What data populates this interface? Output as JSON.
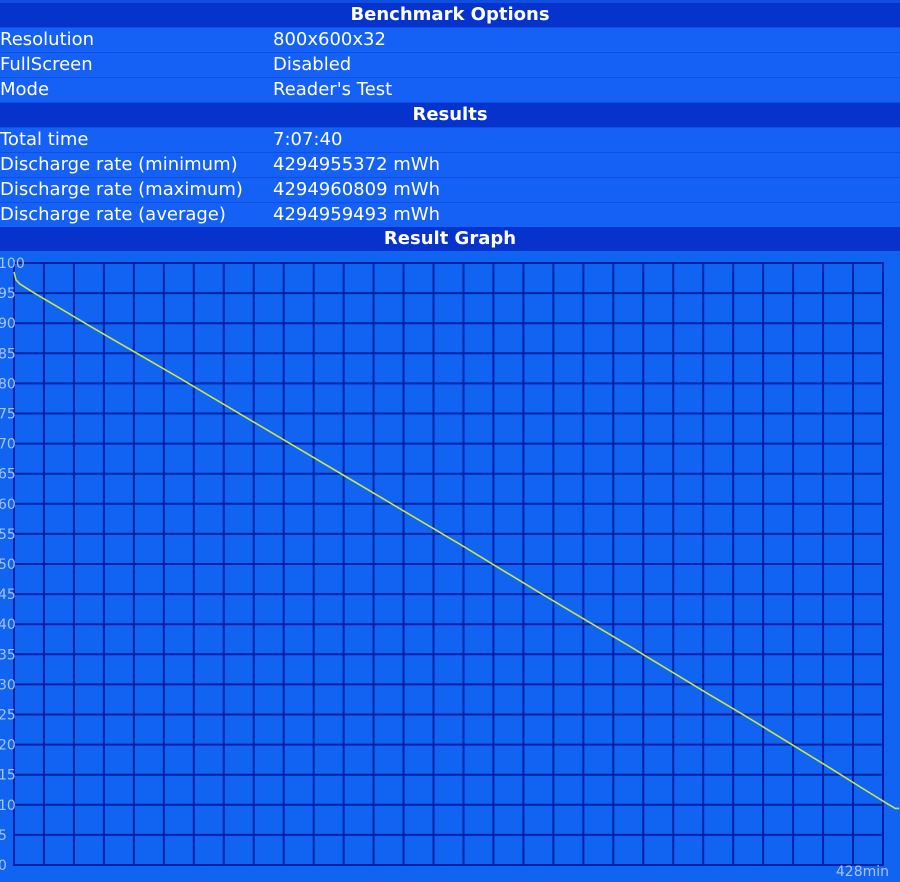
{
  "sections": {
    "options": "Benchmark Options",
    "results": "Results",
    "graph": "Result Graph"
  },
  "options": [
    {
      "label": "Resolution",
      "value": "800x600x32"
    },
    {
      "label": "FullScreen",
      "value": "Disabled"
    },
    {
      "label": "Mode",
      "value": "Reader's Test"
    }
  ],
  "results": [
    {
      "label": "Total time",
      "value": "7:07:40"
    },
    {
      "label": "Discharge rate (minimum)",
      "value": "4294955372 mWh"
    },
    {
      "label": "Discharge rate (maximum)",
      "value": "4294960809 mWh"
    },
    {
      "label": "Discharge rate (average)",
      "value": "4294959493 mWh"
    }
  ],
  "chart_data": {
    "type": "line",
    "title": "",
    "xlabel": "",
    "ylabel": "",
    "x_end_label": "428min",
    "xlim": [
      0,
      428
    ],
    "ylim": [
      0,
      100
    ],
    "y_ticks": [
      100,
      95,
      90,
      85,
      80,
      75,
      70,
      65,
      60,
      55,
      50,
      45,
      40,
      35,
      30,
      25,
      20,
      15,
      10,
      5,
      0
    ],
    "y_tick_labels": [
      "100",
      "95",
      "90",
      "85",
      "80",
      "75",
      "70",
      "65",
      "60",
      "55",
      "50",
      "45",
      "40",
      "35",
      "30",
      "25",
      "20",
      "15",
      "10",
      "5",
      "0"
    ],
    "grid": true,
    "x_grid_lines": 29,
    "colors": {
      "background": "#1163f2",
      "grid": "#0522a6",
      "line": "#c8e64a",
      "label": "#a9c4ff"
    },
    "series": [
      {
        "x": [
          0,
          1,
          3,
          10,
          20,
          40,
          60,
          80,
          100,
          120,
          140,
          160,
          180,
          200,
          220,
          240,
          260,
          280,
          300,
          320,
          340,
          360,
          375,
          402,
          418,
          431,
          433,
          434,
          436
        ],
        "values": [
          98.5,
          97.2,
          96.5,
          95.0,
          93.0,
          89.0,
          85.1,
          81.2,
          77.2,
          73.2,
          69.2,
          65.2,
          61.2,
          57.2,
          53.2,
          49.1,
          45.0,
          41.0,
          37.0,
          32.9,
          28.8,
          24.8,
          21.7,
          16.1,
          12.7,
          10.0,
          9.6,
          9.4,
          9.4
        ]
      }
    ]
  }
}
